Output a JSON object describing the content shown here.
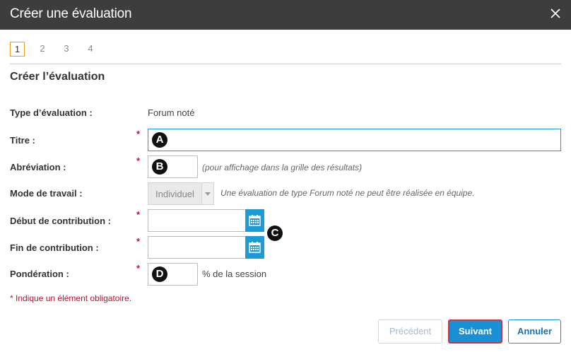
{
  "dialog": {
    "title": "Créer une évaluation"
  },
  "steps": [
    "1",
    "2",
    "3",
    "4"
  ],
  "section_title": "Créer l’évaluation",
  "form": {
    "type_label": "Type d’évaluation :",
    "type_value": "Forum noté",
    "title_label": "Titre :",
    "title_value": "",
    "abbrev_label": "Abréviation :",
    "abbrev_value": "",
    "abbrev_hint": "(pour affichage dans la grille des résultats)",
    "mode_label": "Mode de travail :",
    "mode_value": "Individuel",
    "mode_hint": "Une évaluation de type Forum noté ne peut être réalisée en équipe.",
    "start_label": "Début de contribution :",
    "start_value": "",
    "end_label": "Fin de contribution :",
    "end_value": "",
    "weight_label": "Pondération :",
    "weight_value": "",
    "weight_suffix": "% de la session",
    "required_mark": "*",
    "required_note": "* Indique un élément obligatoire."
  },
  "callouts": [
    "A",
    "B",
    "C",
    "D"
  ],
  "buttons": {
    "prev": "Précédent",
    "next": "Suivant",
    "cancel": "Annuler"
  },
  "colors": {
    "titlebar": "#3d3d3d",
    "accent_blue": "#1d9bd7",
    "required_red": "#c8102e",
    "active_step_border": "#e8a21c"
  }
}
